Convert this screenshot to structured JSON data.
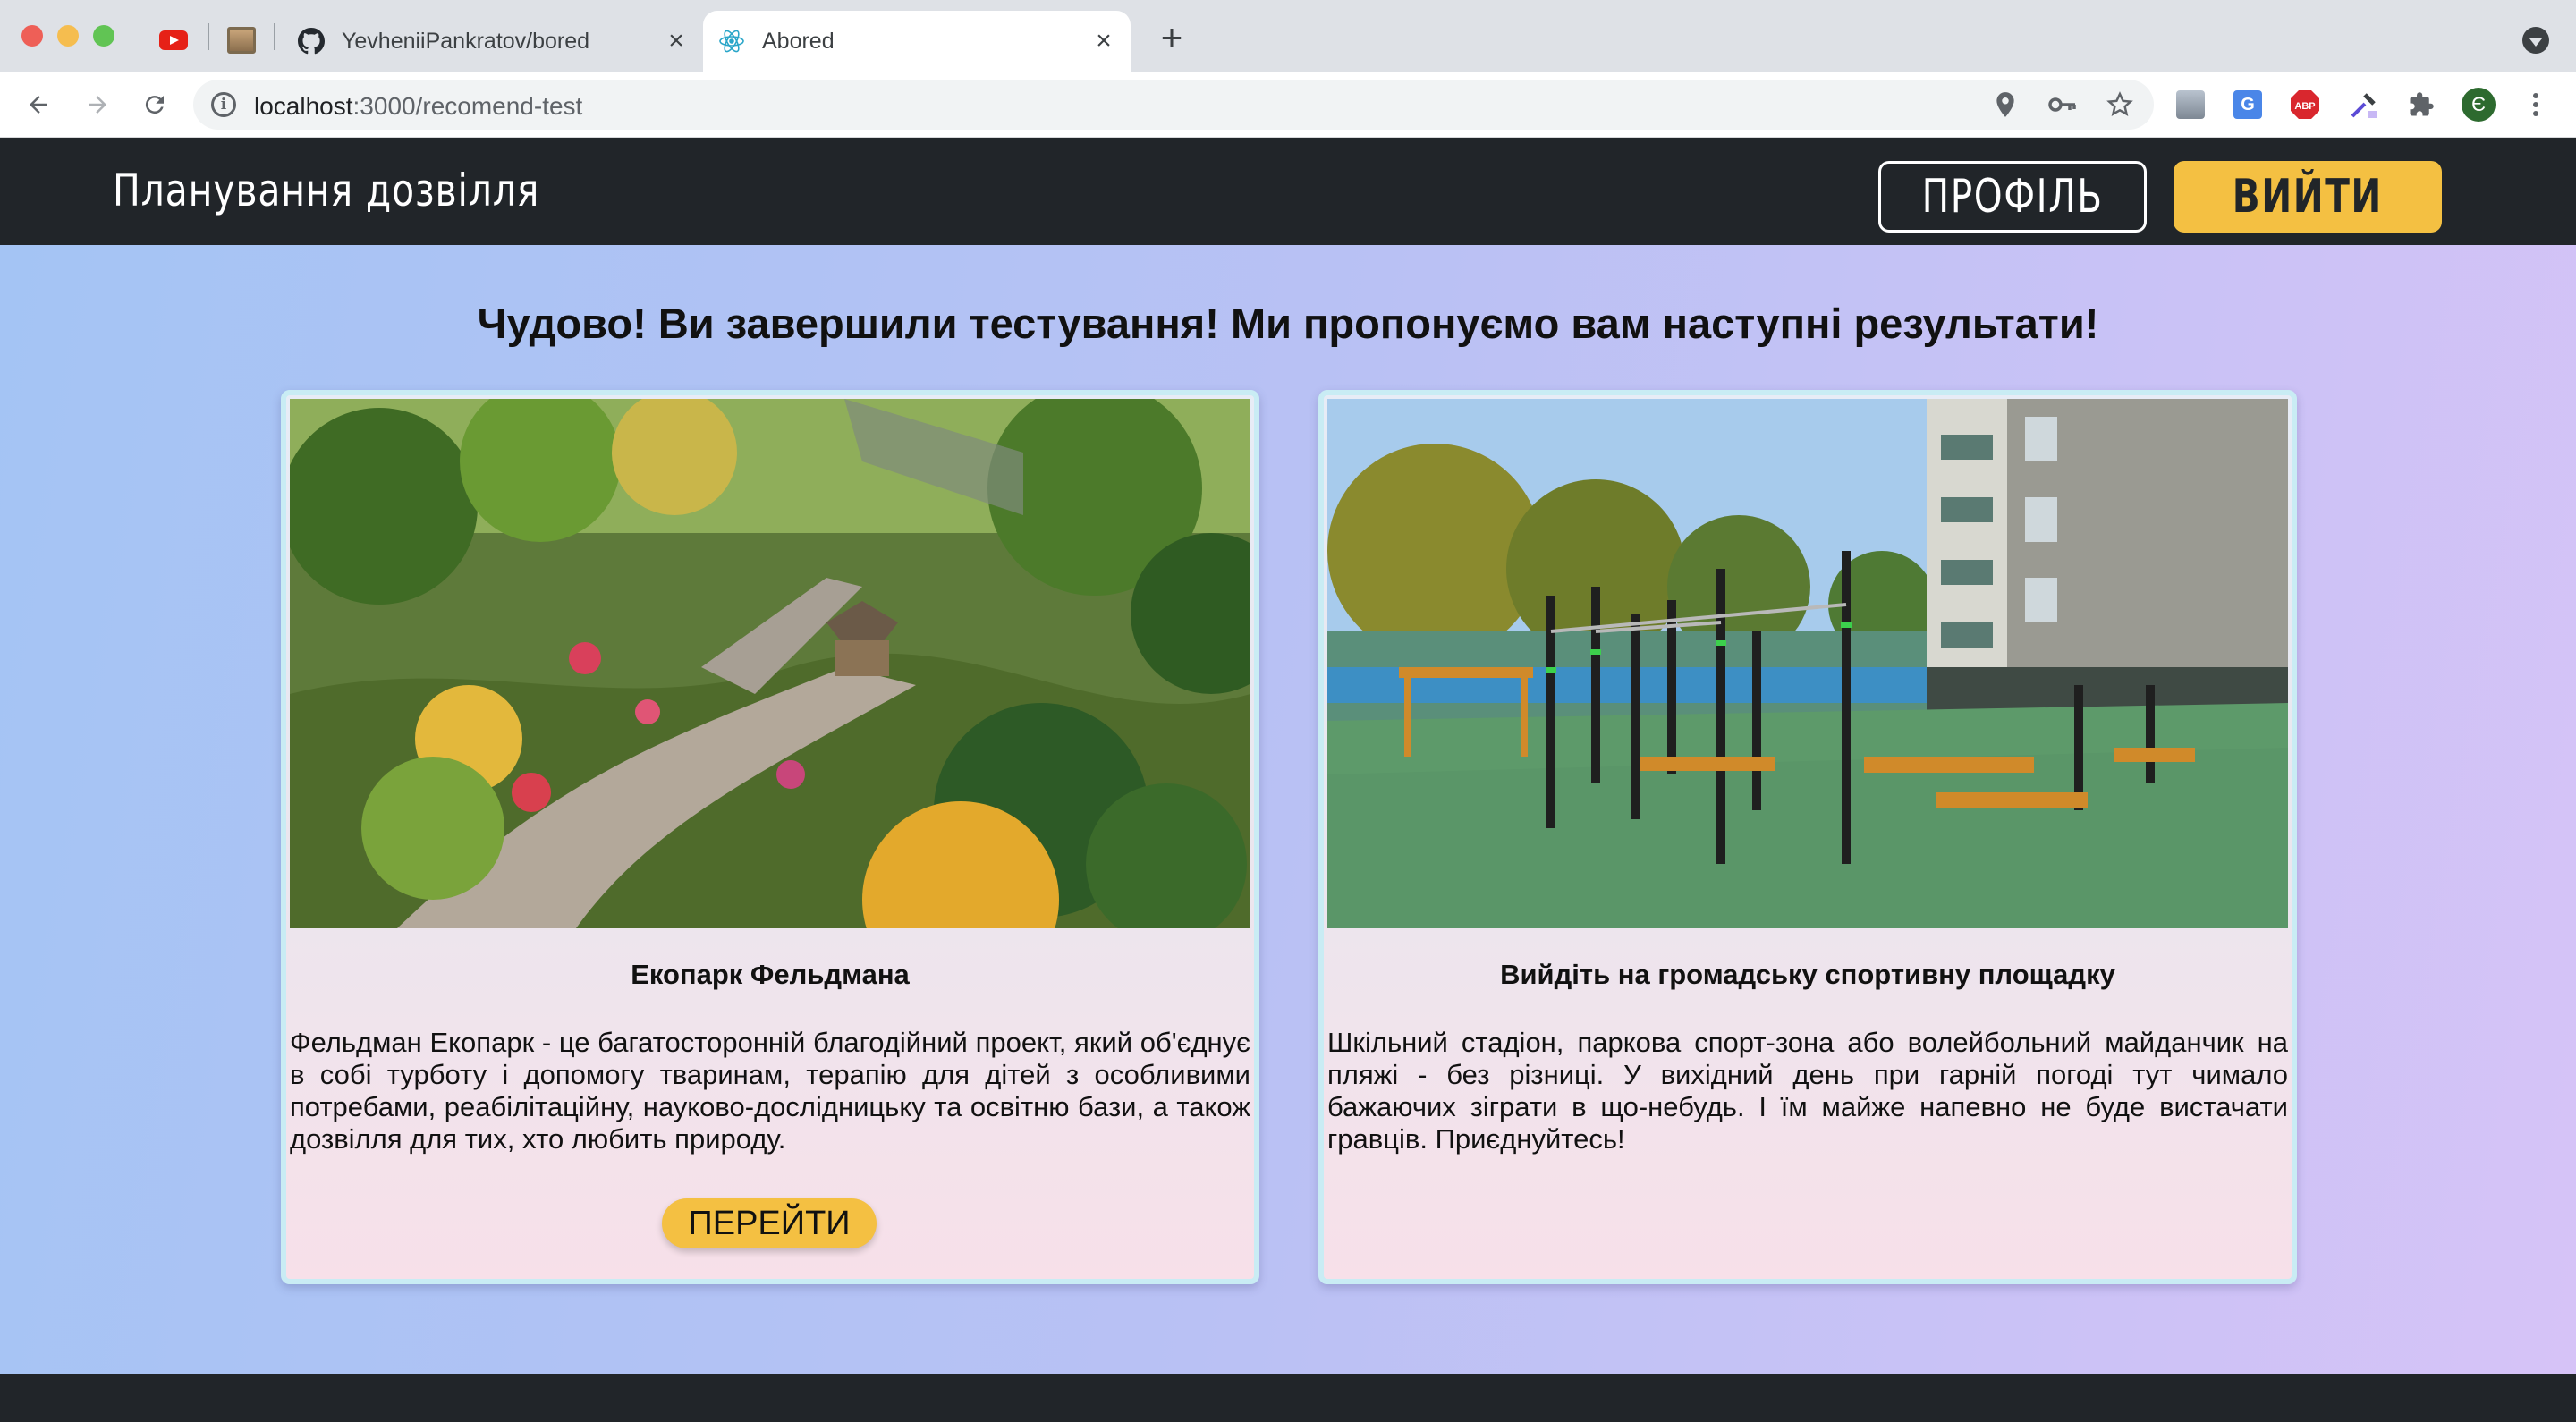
{
  "browser": {
    "tabs": [
      {
        "title": "YevheniiPankratov/bored",
        "close": "×"
      },
      {
        "title": "Abored",
        "close": "×"
      }
    ],
    "new_tab": "+",
    "address": {
      "host": "localhost",
      "path": ":3000/recomend-test"
    },
    "profile_initial": "Є",
    "icons": [
      "youtube-icon",
      "image-icon",
      "github-icon",
      "react-icon",
      "location-icon",
      "key-icon",
      "star-icon",
      "extension-icons",
      "puzzle-icon",
      "menu-icon"
    ]
  },
  "header": {
    "brand": "Планування дозвілля",
    "profile_button": "ПРОФІЛЬ",
    "logout_button": "ВИЙТИ"
  },
  "main": {
    "heading": "Чудово! Ви завершили тестування! Ми пропонуємо вам наступні результати!",
    "cards": [
      {
        "title": "Екопарк Фельдмана",
        "text": "Фельдман Екопарк - це багатосторонній благодійний проект, який об'єднує в собі турботу і допомогу тваринам, терапію для дітей з особливими потребами, реабілітаційну, науково-дослідницьку та освітню бази, а також дозвілля для тих, хто любить природу.",
        "button": "ПЕРЕЙТИ"
      },
      {
        "title": "Вийдіть на громадську спортивну площадку",
        "text": "Шкільний стадіон, паркова спорт-зона або волейбольний майданчик на пляжі - без різниці. У вихідний день при гарній погоді тут чимало бажаючих зіграти в що-небудь. І їм майже напевно не буде вистачати гравців. Приєднуйтесь!"
      }
    ]
  },
  "colors": {
    "header_bg": "#212529",
    "accent": "#f4c042",
    "bg_left": "#a4c4f4",
    "bg_right": "#d6c3f7"
  }
}
